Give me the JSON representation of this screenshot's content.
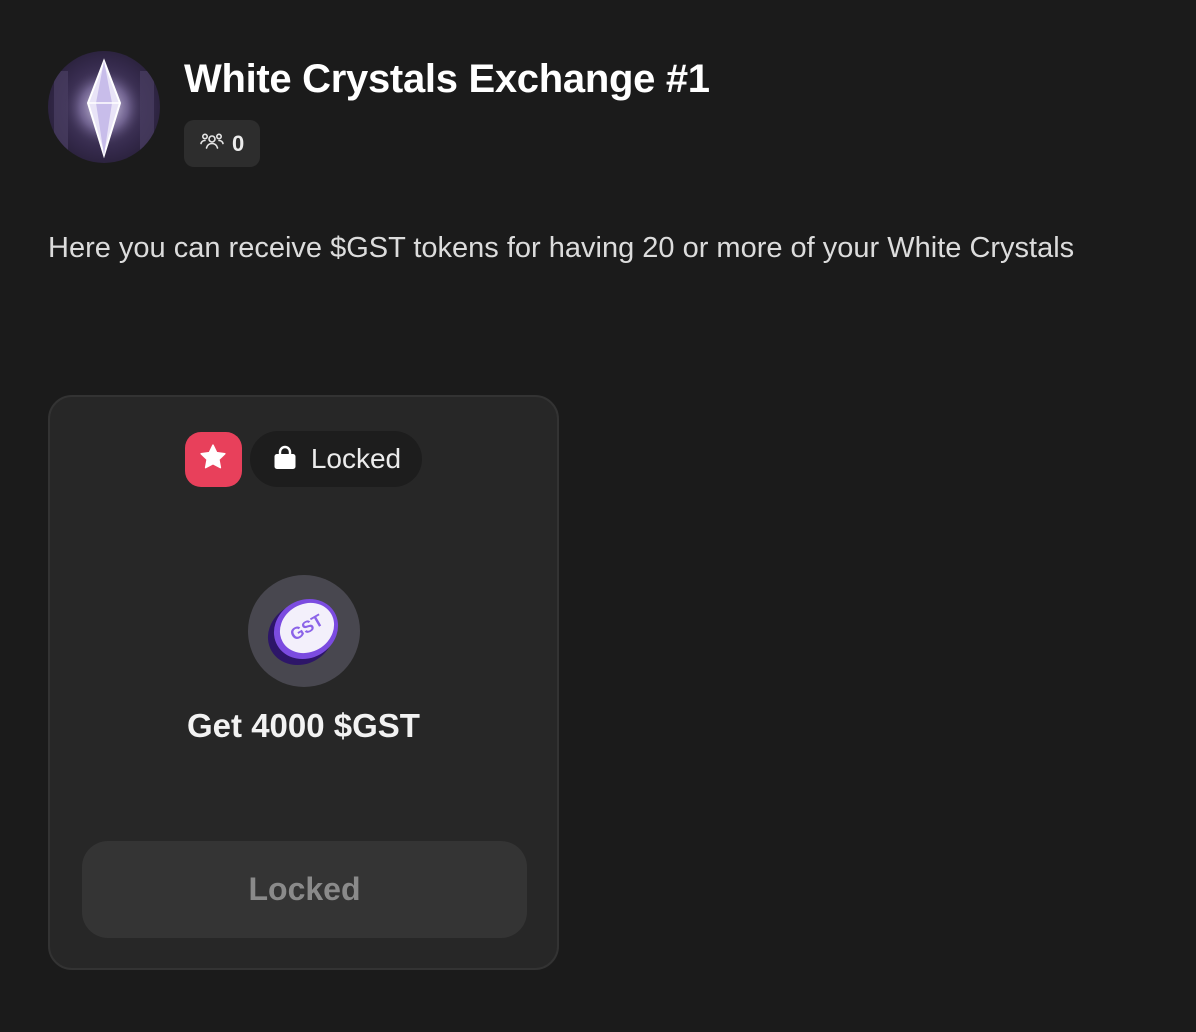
{
  "quest": {
    "title": "White Crystals Exchange #1",
    "participants_count": "0",
    "description": "Here you can receive $GST tokens for having 20 or more of your White Crystals"
  },
  "card": {
    "status_label": "Locked",
    "reward_label": "Get 4000 $GST",
    "token_text": "GST",
    "button_label": "Locked"
  },
  "icons": {
    "avatar": "white-crystal-image",
    "participants": "users-icon",
    "badge": "star-icon",
    "status": "lock-icon",
    "token": "gst-token-coin"
  },
  "colors": {
    "background": "#1b1b1b",
    "card": "#272727",
    "star_badge": "#e8405b",
    "token_purple": "#6b3fd6"
  }
}
